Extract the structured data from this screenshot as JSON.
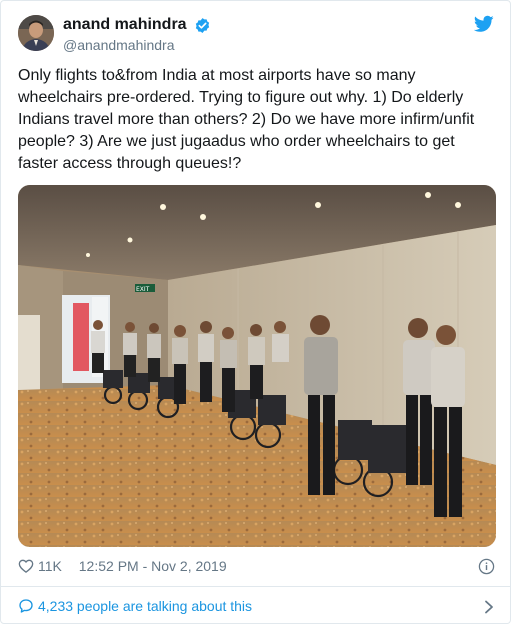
{
  "author": {
    "display_name": "anand mahindra",
    "handle": "@anandmahindra"
  },
  "tweet": {
    "text": "Only flights to&from India at most airports have so many wheelchairs pre-ordered. Trying to figure out why. 1) Do elderly Indians travel more than others? 2) Do we have more infirm/unfit people? 3) Are we just jugaadus who order wheelchairs to get faster access through queues!?"
  },
  "media": {
    "sign_text": "EXIT"
  },
  "meta": {
    "likes": "11K",
    "timestamp": "12:52 PM - Nov 2, 2019"
  },
  "conversation": {
    "label": "4,233 people are talking about this"
  },
  "colors": {
    "accent": "#1b95e0",
    "verified": "#1da1f2",
    "secondary_text": "#657786",
    "border": "#e1e8ed"
  },
  "icons": {
    "verified": "verified-badge-icon",
    "logo": "twitter-bird-icon",
    "like": "heart-icon",
    "info": "info-icon",
    "conversation": "speech-bubble-icon",
    "more": "chevron-right-icon"
  }
}
